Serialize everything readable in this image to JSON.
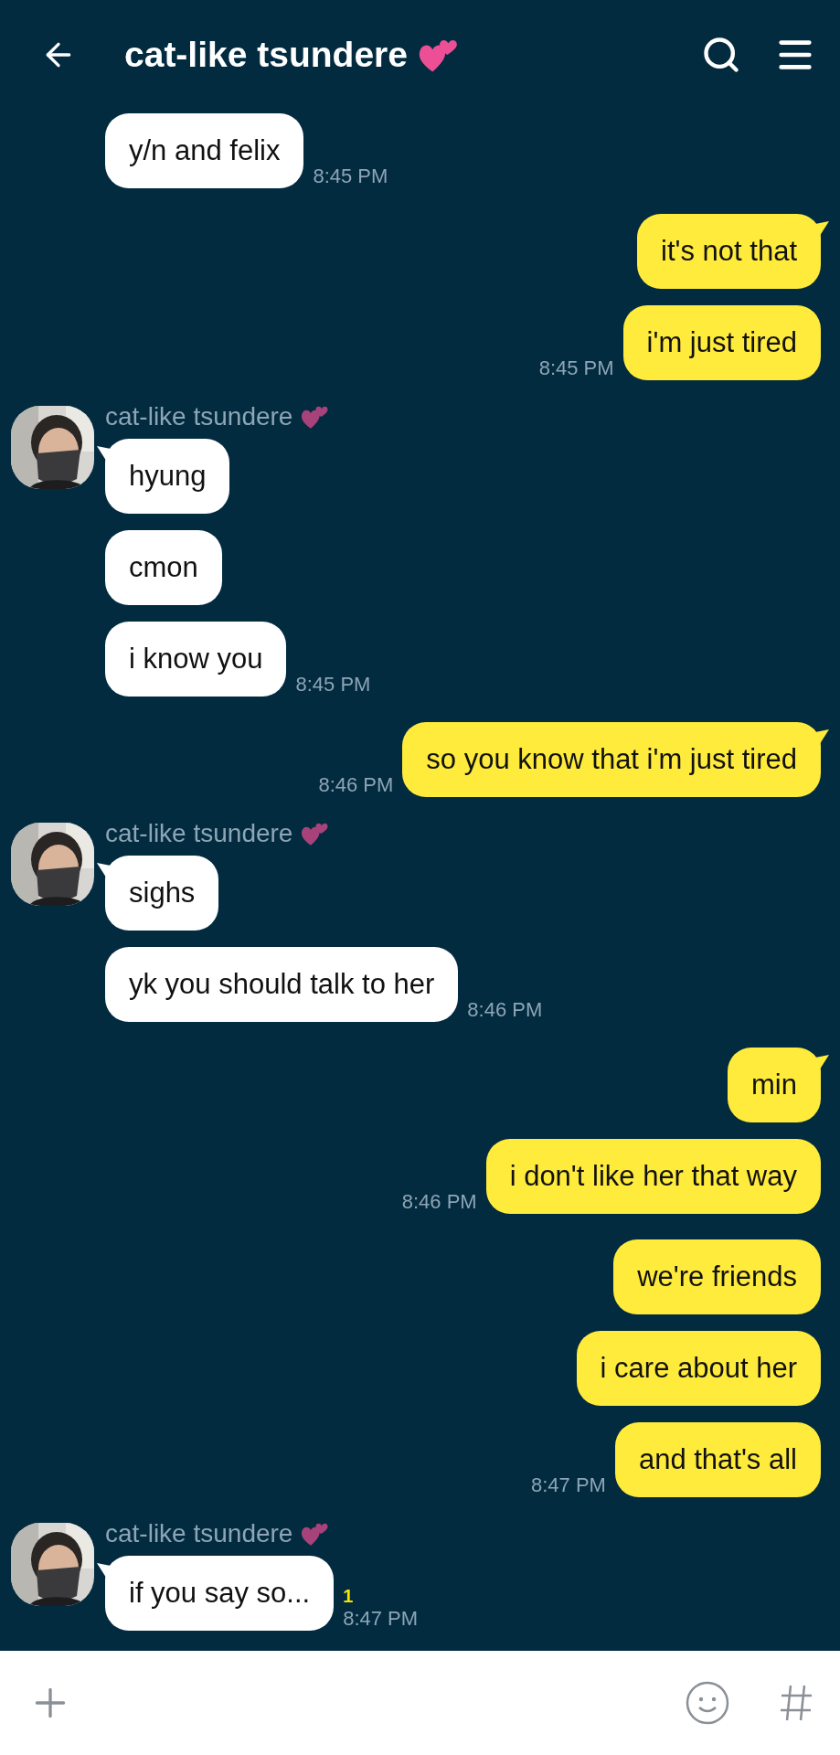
{
  "header": {
    "title": "cat-like tsundere"
  },
  "groups": [
    {
      "kind": "them",
      "continued": true,
      "messages": [
        "y/n and felix"
      ],
      "time": "8:45 PM"
    },
    {
      "kind": "me",
      "messages": [
        "it's not that",
        "i'm just tired"
      ],
      "time": "8:45 PM"
    },
    {
      "kind": "them",
      "name": "cat-like tsundere",
      "messages": [
        "hyung",
        "cmon",
        "i know you"
      ],
      "time": "8:45 PM"
    },
    {
      "kind": "me",
      "messages": [
        "so you know that i'm just tired"
      ],
      "time": "8:46 PM"
    },
    {
      "kind": "them",
      "name": "cat-like tsundere",
      "messages": [
        "sighs",
        "yk you should talk to her"
      ],
      "time": "8:46 PM"
    },
    {
      "kind": "me",
      "messages": [
        "min",
        "i don't like her that way"
      ],
      "time": "8:46 PM"
    },
    {
      "kind": "me",
      "continued": true,
      "messages": [
        "we're friends",
        "i care about her",
        "and that's all"
      ],
      "time": "8:47 PM"
    },
    {
      "kind": "them",
      "name": "cat-like tsundere",
      "messages": [
        "if you say so..."
      ],
      "unread": "1",
      "time": "8:47 PM"
    }
  ]
}
